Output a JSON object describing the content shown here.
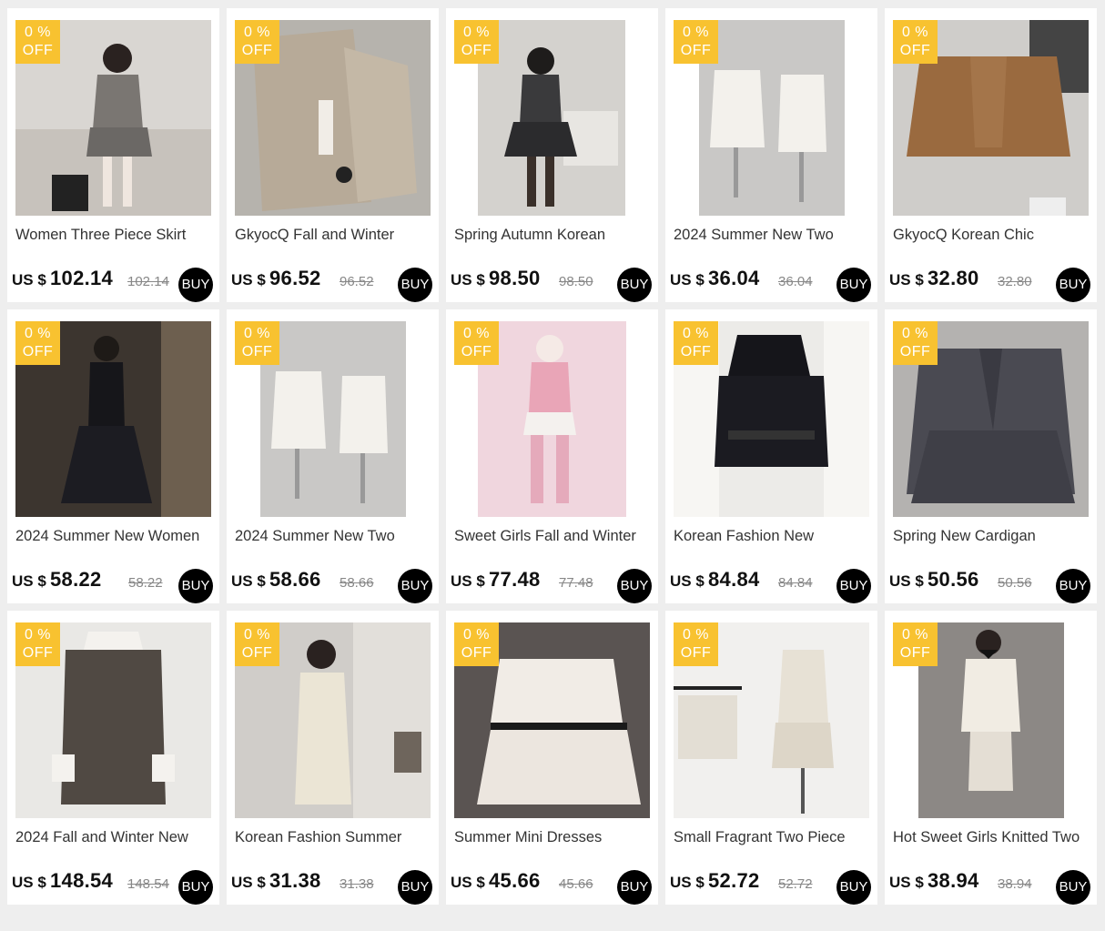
{
  "products": [
    {
      "badge_pct": "0 %",
      "badge_off": "OFF",
      "title": "Women Three Piece Skirt",
      "currency": "US $",
      "price": "102.14",
      "old_price": "102.14",
      "buy": "BUY"
    },
    {
      "badge_pct": "0 %",
      "badge_off": "OFF",
      "title": "GkyocQ Fall and Winter",
      "currency": "US $",
      "price": "96.52",
      "old_price": "96.52",
      "buy": "BUY"
    },
    {
      "badge_pct": "0 %",
      "badge_off": "OFF",
      "title": "Spring Autumn Korean",
      "currency": "US $",
      "price": "98.50",
      "old_price": "98.50",
      "buy": "BUY"
    },
    {
      "badge_pct": "0 %",
      "badge_off": "OFF",
      "title": "2024 Summer New Two",
      "currency": "US $",
      "price": "36.04",
      "old_price": "36.04",
      "buy": "BUY"
    },
    {
      "badge_pct": "0 %",
      "badge_off": "OFF",
      "title": "GkyocQ Korean Chic",
      "currency": "US $",
      "price": "32.80",
      "old_price": "32.80",
      "buy": "BUY"
    },
    {
      "badge_pct": "0 %",
      "badge_off": "OFF",
      "title": "2024 Summer New Women",
      "currency": "US $",
      "price": "58.22",
      "old_price": "58.22",
      "buy": "BUY"
    },
    {
      "badge_pct": "0 %",
      "badge_off": "OFF",
      "title": "2024 Summer New Two",
      "currency": "US $",
      "price": "58.66",
      "old_price": "58.66",
      "buy": "BUY"
    },
    {
      "badge_pct": "0 %",
      "badge_off": "OFF",
      "title": "Sweet Girls Fall and Winter",
      "currency": "US $",
      "price": "77.48",
      "old_price": "77.48",
      "buy": "BUY"
    },
    {
      "badge_pct": "0 %",
      "badge_off": "OFF",
      "title": "Korean Fashion New",
      "currency": "US $",
      "price": "84.84",
      "old_price": "84.84",
      "buy": "BUY"
    },
    {
      "badge_pct": "0 %",
      "badge_off": "OFF",
      "title": "Spring New Cardigan",
      "currency": "US $",
      "price": "50.56",
      "old_price": "50.56",
      "buy": "BUY"
    },
    {
      "badge_pct": "0 %",
      "badge_off": "OFF",
      "title": "2024 Fall and Winter New",
      "currency": "US $",
      "price": "148.54",
      "old_price": "148.54",
      "buy": "BUY"
    },
    {
      "badge_pct": "0 %",
      "badge_off": "OFF",
      "title": "Korean Fashion Summer",
      "currency": "US $",
      "price": "31.38",
      "old_price": "31.38",
      "buy": "BUY"
    },
    {
      "badge_pct": "0 %",
      "badge_off": "OFF",
      "title": "Summer Mini Dresses",
      "currency": "US $",
      "price": "45.66",
      "old_price": "45.66",
      "buy": "BUY"
    },
    {
      "badge_pct": "0 %",
      "badge_off": "OFF",
      "title": "Small Fragrant Two Piece",
      "currency": "US $",
      "price": "52.72",
      "old_price": "52.72",
      "buy": "BUY"
    },
    {
      "badge_pct": "0 %",
      "badge_off": "OFF",
      "title": "Hot Sweet Girls Knitted Two",
      "currency": "US $",
      "price": "38.94",
      "old_price": "38.94",
      "buy": "BUY"
    }
  ],
  "colors": {
    "badge": "#f8c230",
    "buy_button": "#000000",
    "page_bg": "#eeeeee"
  }
}
